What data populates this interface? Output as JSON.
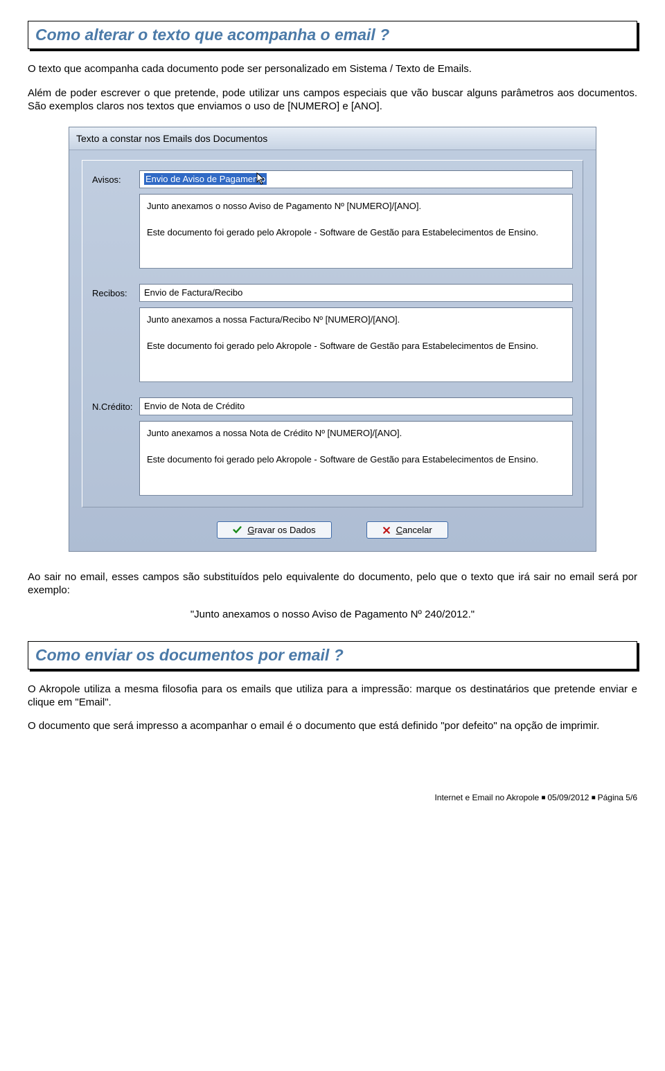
{
  "heading1": "Como alterar o texto que acompanha o email ?",
  "para1": "O texto que acompanha cada documento pode ser personalizado em Sistema / Texto de Emails.",
  "para2": "Além de poder escrever o que pretende, pode utilizar uns campos especiais que vão buscar alguns parâmetros aos documentos. São exemplos claros nos textos que enviamos o uso de [NUMERO] e [ANO].",
  "window": {
    "title": "Texto a constar nos Emails dos Documentos",
    "groups": [
      {
        "label": "Avisos:",
        "subject": "Envio de Aviso de Pagamento",
        "selected": true,
        "body_l1": "Junto anexamos o nosso Aviso de Pagamento Nº [NUMERO]/[ANO].",
        "body_l2": "Este documento foi gerado pelo Akropole - Software de Gestão para Estabelecimentos de Ensino."
      },
      {
        "label": "Recibos:",
        "subject": "Envio de Factura/Recibo",
        "selected": false,
        "body_l1": "Junto anexamos a nossa Factura/Recibo Nº [NUMERO]/[ANO].",
        "body_l2": "Este documento foi gerado pelo Akropole - Software de Gestão para Estabelecimentos de Ensino."
      },
      {
        "label": "N.Crédito:",
        "subject": "Envio de Nota de Crédito",
        "selected": false,
        "body_l1": "Junto anexamos a nossa Nota de Crédito Nº [NUMERO]/[ANO].",
        "body_l2": "Este documento foi gerado pelo Akropole - Software de Gestão para Estabelecimentos de Ensino."
      }
    ],
    "save_prefix": "G",
    "save_rest": "ravar os Dados",
    "cancel_prefix": "C",
    "cancel_rest": "ancelar"
  },
  "para3": "Ao sair no email, esses campos são substituídos pelo equivalente do documento, pelo que o texto que irá sair no email será por exemplo:",
  "quote": "\"Junto anexamos o nosso Aviso de Pagamento Nº 240/2012.\"",
  "heading2": "Como enviar os documentos por email ?",
  "para4": "O Akropole utiliza a mesma filosofia para os emails que utiliza para a impressão: marque os destinatários que pretende enviar e clique em \"Email\".",
  "para5": "O documento que será impresso a acompanhar o email é o documento que está definido \"por defeito\" na opção de imprimir.",
  "footer": {
    "left": "Internet e Email no Akropole",
    "date": "05/09/2012",
    "page": "Página 5/6"
  }
}
